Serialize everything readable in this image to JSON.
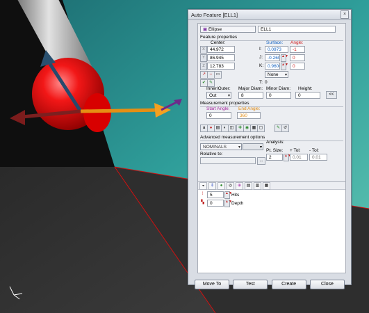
{
  "dialog": {
    "title": "Auto Feature [ELL1]",
    "close_symbol": "×"
  },
  "feature": {
    "type_label": "Ellipse",
    "name": "ELL1"
  },
  "properties": {
    "header": "Feature properties",
    "center_label": "Center:",
    "surface_label": "Surface:",
    "angle_label": "Angle:",
    "x_value": "44.972",
    "y_value": "86.945",
    "z_value": "12.783",
    "i_label": "I:",
    "j_label": "J:",
    "k_label": "K:",
    "i_value": "0.0973",
    "j_value": "-0.2605",
    "k_value": "0.9606",
    "angle_i": "-1",
    "angle_j": "0",
    "angle_k": "0",
    "none_select": "None",
    "t_label": "T:",
    "t_value": "0",
    "inner_outer_label": "Inner/Outer:",
    "inner_outer_value": "Out",
    "major_diam_label": "Major Diam:",
    "major_diam_value": "8",
    "minor_diam_label": "Minor Diam:",
    "minor_diam_value": "0",
    "height_label": "Height:",
    "height_value": "0",
    "collapse_button": "<<"
  },
  "measurement": {
    "header": "Measurement properties",
    "start_angle_label": "Start Angle:",
    "end_angle_label": "End Angle:",
    "start_angle_value": "0",
    "end_angle_value": "360"
  },
  "advanced": {
    "header": "Advanced measurement options",
    "nominals_value": "NOMINALS",
    "analysis_label": "Analysis:",
    "relative_to_label": "Relative to:",
    "pt_size_label": "Pt. Size:",
    "plus_tol_label": "+ Tol:",
    "minus_tol_label": "- Tol:",
    "pt_size_value": "2",
    "plus_tol_value": "0.01",
    "minus_tol_value": "0.01",
    "browse_button": "..."
  },
  "hits": {
    "hits_value": "5",
    "hits_label": "Hits",
    "depth_value": "0",
    "depth_label": "Depth"
  },
  "buttons": {
    "move_to": "Move To",
    "test": "Test",
    "create": "Create",
    "close": "Close"
  },
  "colors": {
    "background_teal": "#3aa2a0",
    "sphere_red": "#e01010",
    "probe_gray": "#9a9a9a",
    "dialog_bg": "#d9dde4"
  },
  "icons": {
    "triad": "axis-triad-icon"
  }
}
